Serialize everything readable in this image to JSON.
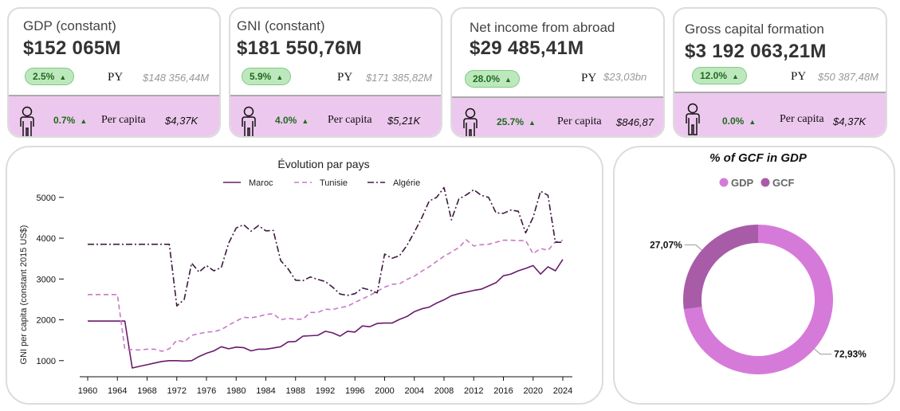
{
  "kpis": [
    {
      "title": "GDP (constant)",
      "value": "$152 065M",
      "change": "2.5%",
      "py_label": "PY",
      "py_value": "$148 356,44M",
      "pc_change": "0.7%",
      "pc_label": "Per capita",
      "pc_value": "$4,37K"
    },
    {
      "title": "GNI (constant)",
      "value": "$181 550,76M",
      "change": "5.9%",
      "py_label": "PY",
      "py_value": "$171 385,82M",
      "pc_change": "4.0%",
      "pc_label": "Per capita",
      "pc_value": "$5,21K"
    },
    {
      "title": "Net income from abroad",
      "value": "$29 485,41M",
      "change": "28.0%",
      "py_label": "PY",
      "py_value": "$23,03bn",
      "pc_change": "25.7%",
      "pc_label": "Per capita",
      "pc_value": "$846,87"
    },
    {
      "title": "Gross capital formation",
      "value": "$3 192 063,21M",
      "change": "12.0%",
      "py_label": "PY",
      "py_value": "$50 387,48M",
      "pc_change": "0.0%",
      "pc_label": "Per capita",
      "pc_value": "$4,37K"
    }
  ],
  "icons": {
    "trend": "triangle-up-icon",
    "person": "person-icon"
  },
  "colors": {
    "positive": "#1e6b1e",
    "pill_bg": "#bde8bd",
    "band": "#edc8ee",
    "maroc": "#6b1a6b",
    "tunisie": "#c879c8",
    "algerie": "#3d1a3d",
    "gdp": "#d67ad9",
    "gcf": "#a85ca8"
  },
  "chart_data": [
    {
      "type": "line",
      "title": "Évolution par pays",
      "xlabel": "",
      "ylabel": "GNI per capita (constant 2015 US$)",
      "xlim": [
        1960,
        2024
      ],
      "ylim": [
        800,
        5250
      ],
      "xticks": [
        1960,
        1964,
        1968,
        1972,
        1976,
        1980,
        1984,
        1988,
        1992,
        1996,
        2000,
        2004,
        2008,
        2012,
        2016,
        2020,
        2024
      ],
      "yticks": [
        1000,
        2000,
        3000,
        4000,
        5000
      ],
      "grid": false,
      "legend_position": "top",
      "x": [
        1960,
        1961,
        1962,
        1963,
        1964,
        1965,
        1966,
        1967,
        1968,
        1969,
        1970,
        1971,
        1972,
        1973,
        1974,
        1975,
        1976,
        1977,
        1978,
        1979,
        1980,
        1981,
        1982,
        1983,
        1984,
        1985,
        1986,
        1987,
        1988,
        1989,
        1990,
        1991,
        1992,
        1993,
        1994,
        1995,
        1996,
        1997,
        1998,
        1999,
        2000,
        2001,
        2002,
        2003,
        2004,
        2005,
        2006,
        2007,
        2008,
        2009,
        2010,
        2011,
        2012,
        2013,
        2014,
        2015,
        2016,
        2017,
        2018,
        2019,
        2020,
        2021,
        2022,
        2023,
        2024
      ],
      "series": [
        {
          "name": "Maroc",
          "style": "solid",
          "values": [
            1970,
            1970,
            1970,
            1970,
            1970,
            1970,
            820,
            860,
            900,
            940,
            980,
            1000,
            1000,
            990,
            1000,
            1100,
            1180,
            1240,
            1340,
            1290,
            1330,
            1320,
            1240,
            1280,
            1280,
            1310,
            1340,
            1460,
            1470,
            1600,
            1610,
            1620,
            1720,
            1680,
            1600,
            1720,
            1700,
            1850,
            1830,
            1910,
            1920,
            1920,
            2010,
            2080,
            2200,
            2270,
            2310,
            2410,
            2490,
            2590,
            2640,
            2680,
            2720,
            2750,
            2830,
            2910,
            3080,
            3120,
            3200,
            3260,
            3330,
            3120,
            3300,
            3200,
            3480
          ]
        },
        {
          "name": "Tunisie",
          "style": "dashed",
          "values": [
            2620,
            2620,
            2620,
            2620,
            2620,
            1280,
            1270,
            1260,
            1280,
            1280,
            1230,
            1290,
            1500,
            1460,
            1620,
            1660,
            1700,
            1710,
            1760,
            1870,
            1970,
            2060,
            2050,
            2080,
            2130,
            2150,
            2000,
            2040,
            2010,
            2020,
            2180,
            2180,
            2260,
            2250,
            2300,
            2330,
            2430,
            2510,
            2600,
            2700,
            2800,
            2870,
            2880,
            2990,
            3070,
            3190,
            3300,
            3430,
            3560,
            3660,
            3770,
            3960,
            3810,
            3840,
            3850,
            3900,
            3950,
            3950,
            3940,
            3940,
            3620,
            3750,
            3700,
            3910,
            3950
          ]
        },
        {
          "name": "Algérie",
          "style": "dashdot",
          "values": [
            3850,
            3850,
            3850,
            3850,
            3850,
            3850,
            3850,
            3850,
            3850,
            3850,
            3850,
            3850,
            2340,
            2500,
            3390,
            3170,
            3330,
            3200,
            3280,
            3880,
            4250,
            4330,
            4170,
            4310,
            4180,
            4190,
            3450,
            3250,
            2970,
            2960,
            3050,
            2990,
            2940,
            2800,
            2630,
            2600,
            2640,
            2780,
            2730,
            2660,
            3610,
            3510,
            3570,
            3820,
            4150,
            4500,
            4910,
            5000,
            5240,
            4450,
            4960,
            5060,
            5190,
            5050,
            5000,
            4620,
            4610,
            4690,
            4660,
            4130,
            4510,
            5150,
            5050,
            3900,
            3900
          ]
        }
      ]
    },
    {
      "type": "pie",
      "title": "% of GCF in GDP",
      "legend_position": "top",
      "labels": [
        "GDP",
        "GCF"
      ],
      "values": [
        72.93,
        27.07
      ],
      "value_labels": [
        "72,93%",
        "27,07%"
      ]
    }
  ]
}
